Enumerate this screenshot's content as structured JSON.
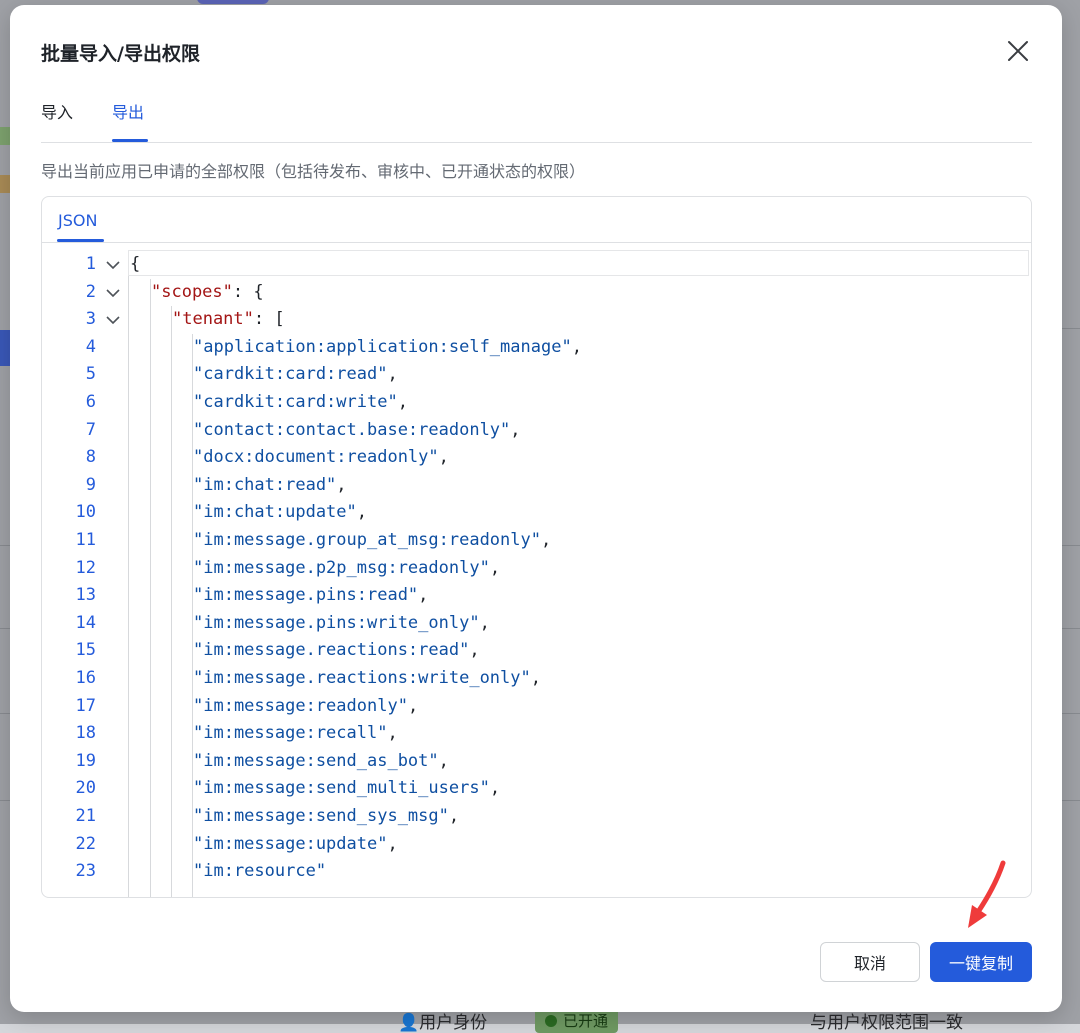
{
  "dialog": {
    "title": "批量导入/导出权限",
    "tabs": [
      {
        "label": "导入",
        "active": false
      },
      {
        "label": "导出",
        "active": true
      }
    ],
    "description": "导出当前应用已申请的全部权限（包括待发布、审核中、已开通状态的权限）",
    "editor": {
      "tab_label": "JSON",
      "lines": [
        {
          "n": "1",
          "indent": 0,
          "fold": true,
          "parts": [
            {
              "t": "p",
              "v": "{"
            }
          ]
        },
        {
          "n": "2",
          "indent": 1,
          "fold": true,
          "parts": [
            {
              "t": "k",
              "v": "\"scopes\""
            },
            {
              "t": "p",
              "v": ": {"
            }
          ]
        },
        {
          "n": "3",
          "indent": 2,
          "fold": true,
          "parts": [
            {
              "t": "k",
              "v": "\"tenant\""
            },
            {
              "t": "p",
              "v": ": ["
            }
          ]
        },
        {
          "n": "4",
          "indent": 3,
          "fold": false,
          "parts": [
            {
              "t": "s",
              "v": "\"application:application:self_manage\""
            },
            {
              "t": "p",
              "v": ","
            }
          ]
        },
        {
          "n": "5",
          "indent": 3,
          "fold": false,
          "parts": [
            {
              "t": "s",
              "v": "\"cardkit:card:read\""
            },
            {
              "t": "p",
              "v": ","
            }
          ]
        },
        {
          "n": "6",
          "indent": 3,
          "fold": false,
          "parts": [
            {
              "t": "s",
              "v": "\"cardkit:card:write\""
            },
            {
              "t": "p",
              "v": ","
            }
          ]
        },
        {
          "n": "7",
          "indent": 3,
          "fold": false,
          "parts": [
            {
              "t": "s",
              "v": "\"contact:contact.base:readonly\""
            },
            {
              "t": "p",
              "v": ","
            }
          ]
        },
        {
          "n": "8",
          "indent": 3,
          "fold": false,
          "parts": [
            {
              "t": "s",
              "v": "\"docx:document:readonly\""
            },
            {
              "t": "p",
              "v": ","
            }
          ]
        },
        {
          "n": "9",
          "indent": 3,
          "fold": false,
          "parts": [
            {
              "t": "s",
              "v": "\"im:chat:read\""
            },
            {
              "t": "p",
              "v": ","
            }
          ]
        },
        {
          "n": "10",
          "indent": 3,
          "fold": false,
          "parts": [
            {
              "t": "s",
              "v": "\"im:chat:update\""
            },
            {
              "t": "p",
              "v": ","
            }
          ]
        },
        {
          "n": "11",
          "indent": 3,
          "fold": false,
          "parts": [
            {
              "t": "s",
              "v": "\"im:message.group_at_msg:readonly\""
            },
            {
              "t": "p",
              "v": ","
            }
          ]
        },
        {
          "n": "12",
          "indent": 3,
          "fold": false,
          "parts": [
            {
              "t": "s",
              "v": "\"im:message.p2p_msg:readonly\""
            },
            {
              "t": "p",
              "v": ","
            }
          ]
        },
        {
          "n": "13",
          "indent": 3,
          "fold": false,
          "parts": [
            {
              "t": "s",
              "v": "\"im:message.pins:read\""
            },
            {
              "t": "p",
              "v": ","
            }
          ]
        },
        {
          "n": "14",
          "indent": 3,
          "fold": false,
          "parts": [
            {
              "t": "s",
              "v": "\"im:message.pins:write_only\""
            },
            {
              "t": "p",
              "v": ","
            }
          ]
        },
        {
          "n": "15",
          "indent": 3,
          "fold": false,
          "parts": [
            {
              "t": "s",
              "v": "\"im:message.reactions:read\""
            },
            {
              "t": "p",
              "v": ","
            }
          ]
        },
        {
          "n": "16",
          "indent": 3,
          "fold": false,
          "parts": [
            {
              "t": "s",
              "v": "\"im:message.reactions:write_only\""
            },
            {
              "t": "p",
              "v": ","
            }
          ]
        },
        {
          "n": "17",
          "indent": 3,
          "fold": false,
          "parts": [
            {
              "t": "s",
              "v": "\"im:message:readonly\""
            },
            {
              "t": "p",
              "v": ","
            }
          ]
        },
        {
          "n": "18",
          "indent": 3,
          "fold": false,
          "parts": [
            {
              "t": "s",
              "v": "\"im:message:recall\""
            },
            {
              "t": "p",
              "v": ","
            }
          ]
        },
        {
          "n": "19",
          "indent": 3,
          "fold": false,
          "parts": [
            {
              "t": "s",
              "v": "\"im:message:send_as_bot\""
            },
            {
              "t": "p",
              "v": ","
            }
          ]
        },
        {
          "n": "20",
          "indent": 3,
          "fold": false,
          "parts": [
            {
              "t": "s",
              "v": "\"im:message:send_multi_users\""
            },
            {
              "t": "p",
              "v": ","
            }
          ]
        },
        {
          "n": "21",
          "indent": 3,
          "fold": false,
          "parts": [
            {
              "t": "s",
              "v": "\"im:message:send_sys_msg\""
            },
            {
              "t": "p",
              "v": ","
            }
          ]
        },
        {
          "n": "22",
          "indent": 3,
          "fold": false,
          "parts": [
            {
              "t": "s",
              "v": "\"im:message:update\""
            },
            {
              "t": "p",
              "v": ","
            }
          ]
        },
        {
          "n": "23",
          "indent": 3,
          "fold": false,
          "parts": [
            {
              "t": "s",
              "v": "\"im:resource\""
            }
          ]
        }
      ]
    },
    "buttons": {
      "cancel": "取消",
      "copy": "一键复制"
    }
  },
  "background": {
    "status_badge": "已开通",
    "identity_label": "用户身份",
    "scope_note": "与用户权限范围一致"
  },
  "colors": {
    "accent": "#245bdb",
    "json_key": "#a31515",
    "json_string": "#0f4fa1",
    "annotation_arrow": "#ef3b3b"
  },
  "icons": {
    "close": "close-icon",
    "fold": "chevron-down-icon",
    "annotation": "red-arrow-icon"
  }
}
